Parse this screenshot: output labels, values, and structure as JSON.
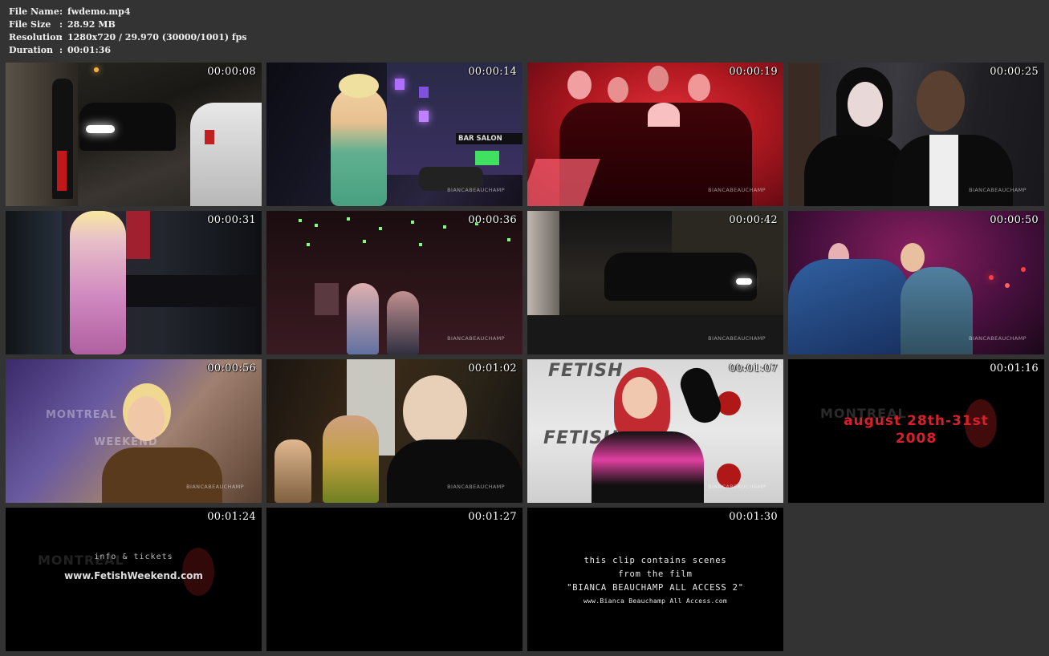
{
  "info": {
    "file_name": {
      "key": "File Name",
      "value": "fwdemo.mp4"
    },
    "file_size": {
      "key": "File Size",
      "value": "28.92 MB"
    },
    "resolution": {
      "key": "Resolution",
      "value": "1280x720 / 29.970 (30000/1001) fps"
    },
    "duration": {
      "key": "Duration",
      "value": "00:01:36"
    },
    "separator": ":"
  },
  "thumbnails": [
    {
      "time": "00:00:08"
    },
    {
      "time": "00:00:14",
      "sign": "BAR SALON",
      "watermark": "BIANCABEAUCHAMP"
    },
    {
      "time": "00:00:19",
      "watermark": "BIANCABEAUCHAMP"
    },
    {
      "time": "00:00:25",
      "watermark": "BIANCABEAUCHAMP"
    },
    {
      "time": "00:00:31"
    },
    {
      "time": "00:00:36",
      "watermark": "BIANCABEAUCHAMP"
    },
    {
      "time": "00:00:42",
      "watermark": "BIANCABEAUCHAMP"
    },
    {
      "time": "00:00:50",
      "watermark": "BIANCABEAUCHAMP"
    },
    {
      "time": "00:00:56",
      "ghost1": "MONTREAL",
      "ghost2": "WEEKEND",
      "watermark": "BIANCABEAUCHAMP"
    },
    {
      "time": "00:01:02",
      "watermark": "BIANCABEAUCHAMP"
    },
    {
      "time": "00:01:07",
      "logo": "FETISH",
      "watermark": "BIANCABEAUCHAMP"
    },
    {
      "time": "00:01:16",
      "ghost1": "MONTREAL",
      "line1": "august 28th-31st",
      "line2": "2008"
    },
    {
      "time": "00:01:24",
      "ghost1": "MONTREAL",
      "line1": "info & tickets",
      "line2": "www.FetishWeekend.com"
    },
    {
      "time": "00:01:27"
    },
    {
      "time": "00:01:30",
      "lines": [
        "this clip contains scenes",
        "from the film",
        "\"BIANCA BEAUCHAMP ALL ACCESS 2\""
      ],
      "url": "www.Bianca Beauchamp All Access.com"
    }
  ]
}
